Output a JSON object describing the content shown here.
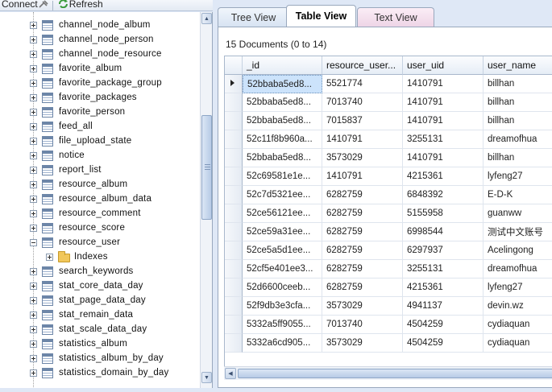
{
  "toolbar": {
    "connect_label": "Connect",
    "refresh_label": "Refresh"
  },
  "tree": {
    "items": [
      {
        "label": "channel_node_album",
        "icon": "table-icon"
      },
      {
        "label": "channel_node_person",
        "icon": "table-icon"
      },
      {
        "label": "channel_node_resource",
        "icon": "table-icon"
      },
      {
        "label": "favorite_album",
        "icon": "table-icon"
      },
      {
        "label": "favorite_package_group",
        "icon": "table-icon"
      },
      {
        "label": "favorite_packages",
        "icon": "table-icon"
      },
      {
        "label": "favorite_person",
        "icon": "table-icon"
      },
      {
        "label": "feed_all",
        "icon": "table-icon"
      },
      {
        "label": "file_upload_state",
        "icon": "table-icon"
      },
      {
        "label": "notice",
        "icon": "table-icon"
      },
      {
        "label": "report_list",
        "icon": "table-icon"
      },
      {
        "label": "resource_album",
        "icon": "table-icon"
      },
      {
        "label": "resource_album_data",
        "icon": "table-icon"
      },
      {
        "label": "resource_comment",
        "icon": "table-icon"
      },
      {
        "label": "resource_score",
        "icon": "table-icon"
      },
      {
        "label": "resource_user",
        "icon": "table-icon",
        "expanded": true
      },
      {
        "label": "Indexes",
        "icon": "folder-icon",
        "child": true
      },
      {
        "label": "search_keywords",
        "icon": "table-icon"
      },
      {
        "label": "stat_core_data_day",
        "icon": "table-icon"
      },
      {
        "label": "stat_page_data_day",
        "icon": "table-icon"
      },
      {
        "label": "stat_remain_data",
        "icon": "table-icon"
      },
      {
        "label": "stat_scale_data_day",
        "icon": "table-icon"
      },
      {
        "label": "statistics_album",
        "icon": "table-icon"
      },
      {
        "label": "statistics_album_by_day",
        "icon": "table-icon"
      },
      {
        "label": "statistics_domain_by_day",
        "icon": "table-icon"
      }
    ]
  },
  "tabs": [
    {
      "label": "Tree View",
      "active": false
    },
    {
      "label": "Table View",
      "active": true
    },
    {
      "label": "Text View",
      "active": false
    }
  ],
  "table": {
    "doc_count": "15 Documents (0 to 14)",
    "columns": [
      "_id",
      "resource_user...",
      "user_uid",
      "user_name"
    ],
    "rows": [
      [
        "52bbaba5ed8...",
        "5521774",
        "1410791",
        "billhan"
      ],
      [
        "52bbaba5ed8...",
        "7013740",
        "1410791",
        "billhan"
      ],
      [
        "52bbaba5ed8...",
        "7015837",
        "1410791",
        "billhan"
      ],
      [
        "52c11f8b960a...",
        "1410791",
        "3255131",
        "dreamofhua"
      ],
      [
        "52bbaba5ed8...",
        "3573029",
        "1410791",
        "billhan"
      ],
      [
        "52c69581e1e...",
        "1410791",
        "4215361",
        "lyfeng27"
      ],
      [
        "52c7d5321ee...",
        "6282759",
        "6848392",
        "E-D-K"
      ],
      [
        "52ce56121ee...",
        "6282759",
        "5155958",
        "guanww"
      ],
      [
        "52ce59a31ee...",
        "6282759",
        "6998544",
        "测试中文账号"
      ],
      [
        "52ce5a5d1ee...",
        "6282759",
        "6297937",
        "Acelingong"
      ],
      [
        "52cf5e401ee3...",
        "6282759",
        "3255131",
        "dreamofhua"
      ],
      [
        "52d6600ceeb...",
        "6282759",
        "4215361",
        "lyfeng27"
      ],
      [
        "52f9db3e3cfa...",
        "3573029",
        "4941137",
        "devin.wz"
      ],
      [
        "5332a5ff9055...",
        "7013740",
        "4504259",
        "cydiaquan"
      ],
      [
        "5332a6cd905...",
        "3573029",
        "4504259",
        "cydiaquan"
      ]
    ]
  }
}
